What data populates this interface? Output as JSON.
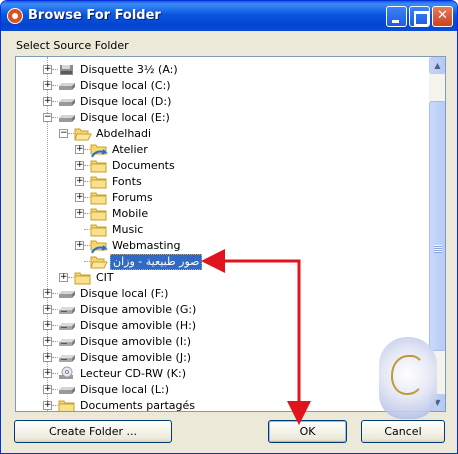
{
  "window": {
    "title": "Browse For Folder",
    "prompt": "Select Source Folder"
  },
  "tree": {
    "items": [
      {
        "label": "Disquette 3½ (A:)",
        "icon": "floppy-drive-icon",
        "level": 0,
        "expander": "plus"
      },
      {
        "label": "Disque local (C:)",
        "icon": "hard-drive-icon",
        "level": 0,
        "expander": "plus"
      },
      {
        "label": "Disque local (D:)",
        "icon": "hard-drive-icon",
        "level": 0,
        "expander": "plus"
      },
      {
        "label": "Disque local (E:)",
        "icon": "hard-drive-icon",
        "level": 0,
        "expander": "minus"
      },
      {
        "label": "Abdelhadi",
        "icon": "folder-open-icon",
        "level": 1,
        "expander": "minus"
      },
      {
        "label": "Atelier",
        "icon": "shared-folder-icon",
        "level": 2,
        "expander": "plus"
      },
      {
        "label": "Documents",
        "icon": "folder-icon",
        "level": 2,
        "expander": "plus"
      },
      {
        "label": "Fonts",
        "icon": "folder-icon",
        "level": 2,
        "expander": "plus"
      },
      {
        "label": "Forums",
        "icon": "folder-icon",
        "level": 2,
        "expander": "plus"
      },
      {
        "label": "Mobile",
        "icon": "folder-icon",
        "level": 2,
        "expander": "plus"
      },
      {
        "label": "Music",
        "icon": "folder-icon",
        "level": 2,
        "expander": "none"
      },
      {
        "label": "Webmasting",
        "icon": "shared-folder-icon",
        "level": 2,
        "expander": "plus"
      },
      {
        "label": "صور طبيعية - وزان",
        "icon": "folder-open-icon",
        "level": 2,
        "expander": "none",
        "selected": true
      },
      {
        "label": "CIT",
        "icon": "folder-icon",
        "level": 1,
        "expander": "plus"
      },
      {
        "label": "Disque local (F:)",
        "icon": "hard-drive-icon",
        "level": 0,
        "expander": "plus"
      },
      {
        "label": "Disque amovible (G:)",
        "icon": "removable-drive-icon",
        "level": 0,
        "expander": "plus"
      },
      {
        "label": "Disque amovible (H:)",
        "icon": "removable-drive-icon",
        "level": 0,
        "expander": "plus"
      },
      {
        "label": "Disque amovible (I:)",
        "icon": "removable-drive-icon",
        "level": 0,
        "expander": "plus"
      },
      {
        "label": "Disque amovible (J:)",
        "icon": "removable-drive-icon",
        "level": 0,
        "expander": "plus"
      },
      {
        "label": "Lecteur CD-RW (K:)",
        "icon": "cd-drive-icon",
        "level": 0,
        "expander": "plus"
      },
      {
        "label": "Disque local (L:)",
        "icon": "hard-drive-icon",
        "level": 0,
        "expander": "plus"
      },
      {
        "label": "Documents partagés",
        "icon": "folder-icon",
        "level": 0,
        "expander": "plus"
      }
    ]
  },
  "buttons": {
    "create_folder": "Create Folder ...",
    "ok": "OK",
    "cancel": "Cancel"
  },
  "colors": {
    "selection": "#316ac5",
    "titlebar": "#0a56e0",
    "arrow": "#e0141c"
  }
}
